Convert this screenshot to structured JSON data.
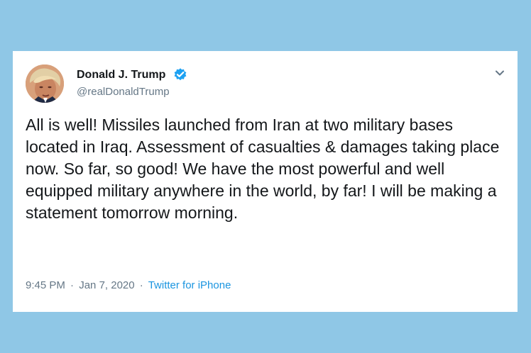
{
  "page": {
    "background_color": "#8fc7e6"
  },
  "tweet": {
    "display_name": "Donald J. Trump",
    "handle": "@realDonaldTrump",
    "verified_color": "#1da1f2",
    "menu_icon": "chevron-down-icon",
    "text": "All is well! Missiles launched from Iran at two military bases located in Iraq. Assessment of casualties & damages taking place now. So far, so good! We have the most powerful and well equipped military anywhere in the world, by far! I will be making a statement tomorrow morning.",
    "time": "9:45 PM",
    "date": "Jan 7, 2020",
    "separator": "·",
    "source": "Twitter for iPhone",
    "link_color": "#1b95e0",
    "text_color": "#14171a",
    "muted_color": "#657786"
  }
}
